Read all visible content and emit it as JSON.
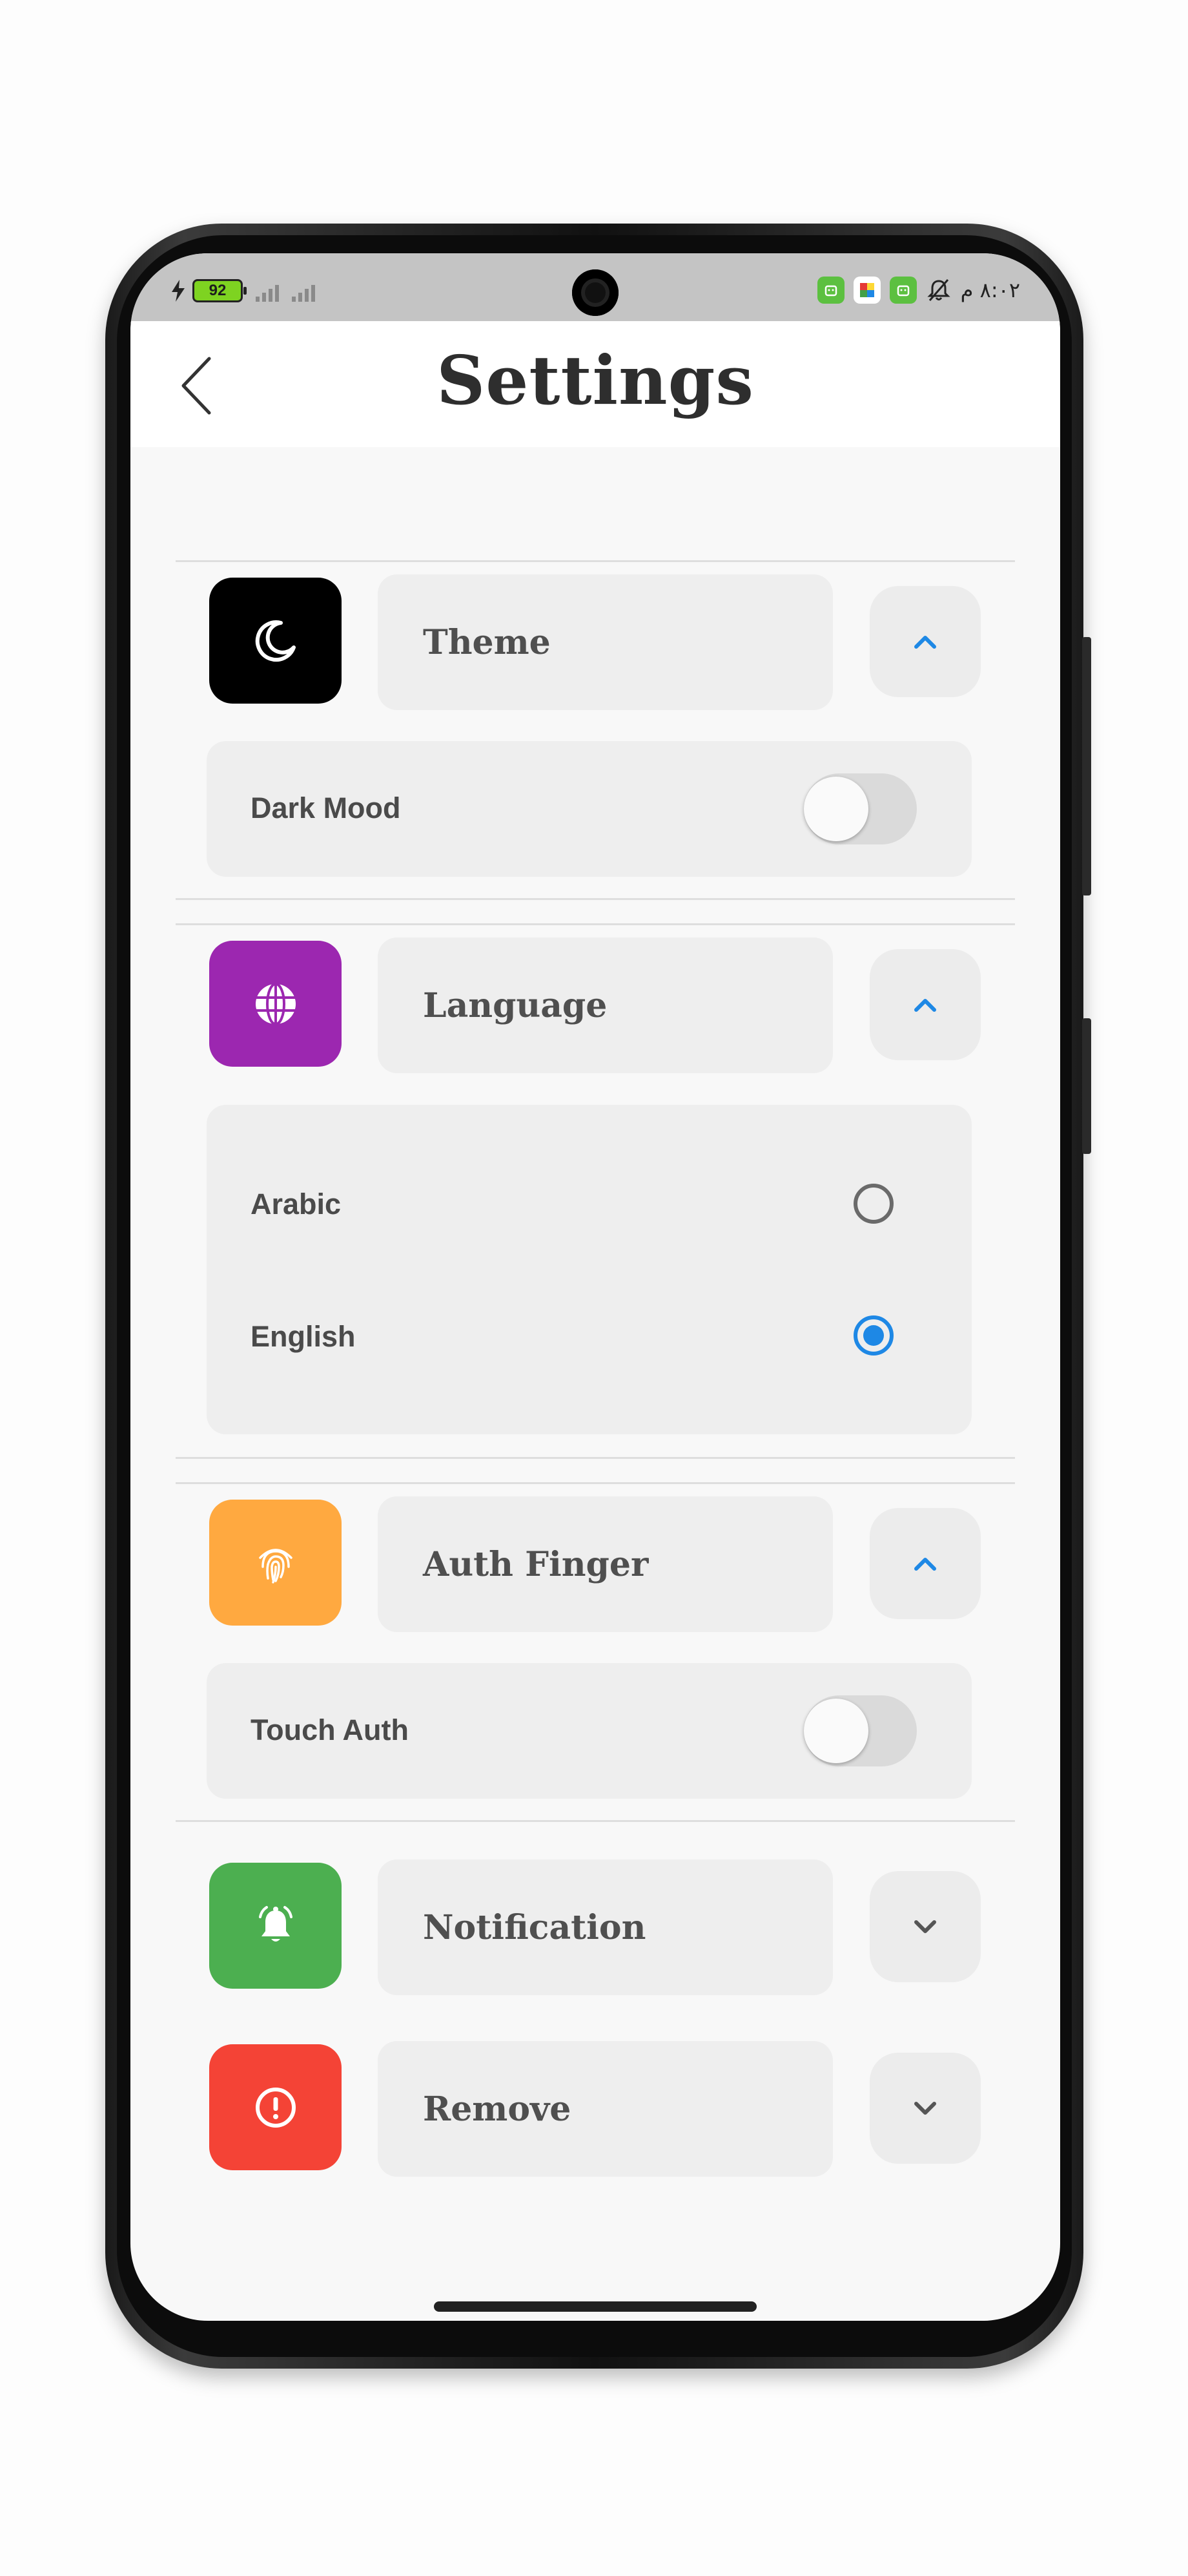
{
  "status_bar": {
    "battery_level": "92",
    "time": "٨:٠٢ م",
    "colors": {
      "battery": "#7ed321",
      "app_icons": "#5cc040"
    }
  },
  "header": {
    "title": "Settings"
  },
  "sections": {
    "theme": {
      "label": "Theme",
      "tile_color": "#000000",
      "icon": "moon-icon",
      "expanded": true,
      "option_label": "Dark Mood",
      "option_on": false
    },
    "language": {
      "label": "Language",
      "tile_color": "#9c27b0",
      "icon": "globe-icon",
      "expanded": true,
      "options": [
        {
          "label": "Arabic",
          "selected": false
        },
        {
          "label": "English",
          "selected": true
        }
      ]
    },
    "auth_finger": {
      "label": "Auth Finger",
      "tile_color": "#ffa940",
      "icon": "fingerprint-icon",
      "expanded": true,
      "option_label": "Touch Auth",
      "option_on": false
    },
    "notification": {
      "label": "Notification",
      "tile_color": "#4caf50",
      "icon": "bell-icon",
      "expanded": false
    },
    "remove": {
      "label": "Remove",
      "tile_color": "#f44336",
      "icon": "alert-icon",
      "expanded": false
    }
  },
  "accent_color": "#1e88e5"
}
